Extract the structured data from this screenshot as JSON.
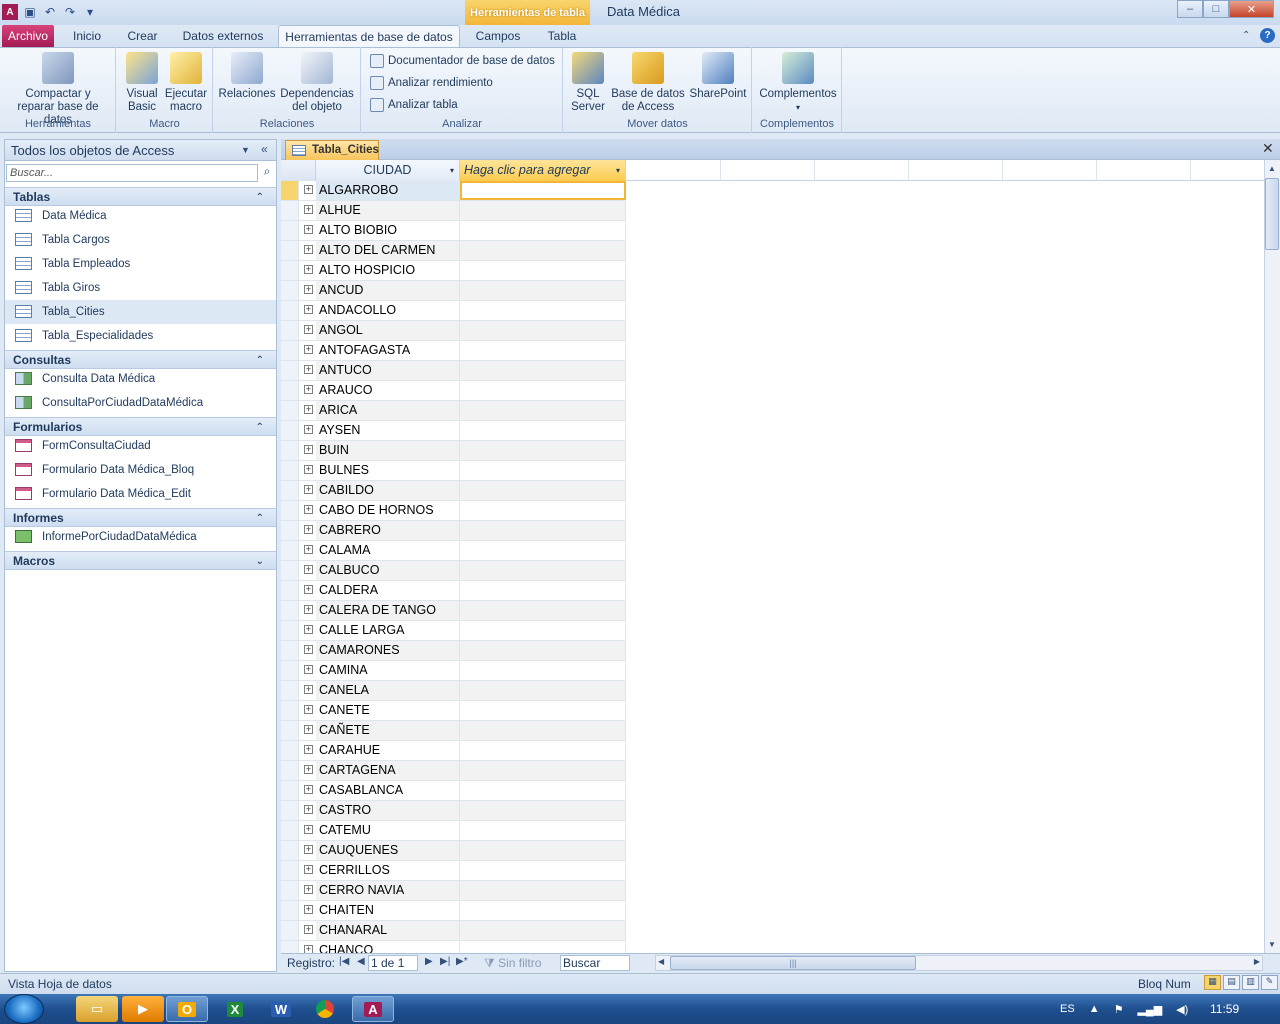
{
  "title_bar": {
    "context_tools": "Herramientas de tabla",
    "app_title": "Data Médica",
    "window_buttons": [
      "–",
      "□",
      "✕"
    ]
  },
  "tabs": {
    "archivo": "Archivo",
    "inicio": "Inicio",
    "crear": "Crear",
    "datos_externos": "Datos externos",
    "herramientas_bd": "Herramientas de base de datos",
    "campos": "Campos",
    "tabla": "Tabla"
  },
  "ribbon": {
    "compactar": "Compactar y reparar base de datos",
    "visual_basic": "Visual Basic",
    "ejecutar_macro": "Ejecutar macro",
    "relaciones": "Relaciones",
    "dependencias": "Dependencias del objeto",
    "documentador": "Documentador de base de datos",
    "analizar_rendimiento": "Analizar rendimiento",
    "analizar_tabla": "Analizar tabla",
    "sql_server": "SQL Server",
    "bd_access": "Base de datos de Access",
    "sharepoint": "SharePoint",
    "complementos": "Complementos",
    "groups": {
      "herramientas": "Herramientas",
      "macro": "Macro",
      "relaciones": "Relaciones",
      "analizar": "Analizar",
      "mover_datos": "Mover datos",
      "complementos": "Complementos"
    }
  },
  "nav": {
    "header": "Todos los objetos de Access",
    "search_placeholder": "Buscar...",
    "categories": {
      "tablas": "Tablas",
      "consultas": "Consultas",
      "formularios": "Formularios",
      "informes": "Informes",
      "macros": "Macros"
    },
    "tablas": [
      "Data Médica",
      "Tabla Cargos",
      "Tabla Empleados",
      "Tabla Giros",
      "Tabla_Cities",
      "Tabla_Especialidades"
    ],
    "consultas": [
      "Consulta Data Médica",
      "ConsultaPorCiudadDataMédica"
    ],
    "formularios": [
      "FormConsultaCiudad",
      "Formulario Data Médica_Bloq",
      "Formulario Data Médica_Edit"
    ],
    "informes": [
      "InformePorCiudadDataMédica"
    ]
  },
  "document": {
    "tab_label": "Tabla_Cities",
    "col_ciudad": "CIUDAD",
    "col_add": "Haga clic para agregar",
    "rows": [
      "ALGARROBO",
      "ALHUE",
      "ALTO BIOBIO",
      "ALTO DEL CARMEN",
      "ALTO HOSPICIO",
      "ANCUD",
      "ANDACOLLO",
      "ANGOL",
      "ANTOFAGASTA",
      "ANTUCO",
      "ARAUCO",
      "ARICA",
      "AYSEN",
      "BUIN",
      "BULNES",
      "CABILDO",
      "CABO DE HORNOS",
      "CABRERO",
      "CALAMA",
      "CALBUCO",
      "CALDERA",
      "CALERA DE TANGO",
      "CALLE LARGA",
      "CAMARONES",
      "CAMINA",
      "CANELA",
      "CANETE",
      "CAÑETE",
      "CARAHUE",
      "CARTAGENA",
      "CASABLANCA",
      "CASTRO",
      "CATEMU",
      "CAUQUENES",
      "CERRILLOS",
      "CERRO NAVIA",
      "CHAITEN",
      "CHANARAL",
      "CHANCO"
    ]
  },
  "record_nav": {
    "label": "Registro:",
    "position": "1 de 1",
    "no_filter": "Sin filtro",
    "search": "Buscar"
  },
  "status": {
    "left": "Vista Hoja de datos",
    "right": "Bloq Num"
  },
  "taskbar": {
    "lang": "ES",
    "clock": "11:59"
  },
  "colors": {
    "accent_archivo": "#a31b55",
    "context_tools": "#f3b638",
    "selection_row": "#dde8f5"
  }
}
